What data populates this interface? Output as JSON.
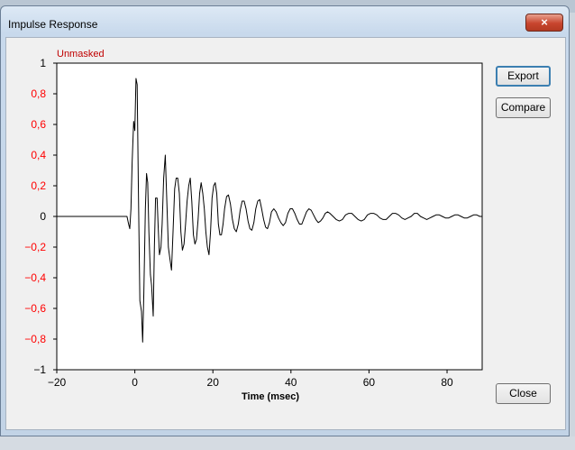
{
  "window": {
    "title": "Impulse Response",
    "close_glyph": "×"
  },
  "status_label": "Unmasked",
  "buttons": {
    "export": "Export",
    "compare": "Compare",
    "close": "Close"
  },
  "colors": {
    "ytick_positive": "#ff0000",
    "ytick_negative": "#ff0000",
    "ytick_axis": "#000000",
    "status": "#c00000"
  },
  "chart_data": {
    "type": "line",
    "title": "",
    "xlabel": "Time (msec)",
    "ylabel": "",
    "xlim": [
      -20,
      89
    ],
    "ylim": [
      -1,
      1
    ],
    "xticks": [
      -20,
      0,
      20,
      40,
      60,
      80
    ],
    "xtick_labels": [
      "−20",
      "0",
      "20",
      "40",
      "60",
      "80"
    ],
    "yticks": [
      1,
      0.8,
      0.6,
      0.4,
      0.2,
      0,
      -0.2,
      -0.4,
      -0.6,
      -0.8,
      -1
    ],
    "ytick_labels": [
      "1",
      "0,8",
      "0,6",
      "0,4",
      "0,2",
      "0",
      "−0,2",
      "−0,4",
      "−0,6",
      "−0,8",
      "−1"
    ],
    "grid": false,
    "series": [
      {
        "name": "",
        "x": [
          -20,
          -2,
          -1.6,
          -1.3,
          -1,
          -0.7,
          -0.3,
          0,
          0.3,
          0.6,
          0.9,
          1.3,
          1.7,
          2,
          2.3,
          2.7,
          3,
          3.3,
          3.6,
          4,
          4.3,
          4.7,
          5,
          5.3,
          5.7,
          6,
          6.3,
          6.7,
          7,
          7.4,
          7.8,
          8.2,
          8.6,
          9,
          9.4,
          9.8,
          10.2,
          10.6,
          11,
          11.4,
          11.8,
          12.2,
          12.6,
          13,
          13.4,
          13.8,
          14.2,
          14.6,
          15,
          15.4,
          15.8,
          16.2,
          16.6,
          17,
          17.4,
          17.8,
          18.2,
          18.6,
          19,
          19.4,
          19.8,
          20.2,
          20.6,
          21,
          21.4,
          21.8,
          22.2,
          22.6,
          23,
          23.5,
          24,
          24.5,
          25,
          25.5,
          26,
          26.5,
          27,
          27.5,
          28,
          28.5,
          29,
          29.5,
          30,
          30.5,
          31,
          31.5,
          32,
          32.5,
          33,
          33.5,
          34,
          34.5,
          35,
          35.6,
          36.2,
          36.8,
          37.4,
          38,
          38.6,
          39.2,
          39.8,
          40.4,
          41,
          41.6,
          42.2,
          42.8,
          43.4,
          44,
          44.6,
          45.2,
          45.8,
          46.4,
          47,
          47.6,
          48.2,
          48.8,
          49.4,
          50,
          50.8,
          51.6,
          52.4,
          53.2,
          54,
          54.8,
          55.6,
          56.4,
          57.2,
          58,
          58.8,
          59.6,
          60.4,
          61.2,
          62,
          62.8,
          63.6,
          64.4,
          65.2,
          66,
          66.8,
          67.6,
          68.4,
          69.2,
          70,
          70.8,
          71.6,
          72.4,
          73.2,
          74,
          74.8,
          75.6,
          76.4,
          77.2,
          78,
          78.8,
          79.6,
          80.4,
          81.2,
          82,
          82.8,
          83.6,
          84.4,
          85.2,
          86,
          86.8,
          87.6,
          88.4,
          89
        ],
        "y": [
          0,
          0,
          -0.05,
          -0.08,
          0.05,
          0.35,
          0.62,
          0.56,
          0.9,
          0.86,
          0.2,
          -0.55,
          -0.62,
          -0.82,
          -0.5,
          0.05,
          0.28,
          0.22,
          -0.1,
          -0.38,
          -0.45,
          -0.65,
          -0.2,
          0.12,
          0.12,
          -0.08,
          -0.25,
          -0.2,
          -0.05,
          0.25,
          0.4,
          0.1,
          -0.2,
          -0.28,
          -0.35,
          -0.1,
          0.18,
          0.25,
          0.25,
          0.15,
          -0.1,
          -0.22,
          -0.18,
          -0.05,
          0.1,
          0.2,
          0.25,
          0.1,
          -0.12,
          -0.18,
          -0.15,
          -0.02,
          0.15,
          0.22,
          0.15,
          0.05,
          -0.1,
          -0.2,
          -0.25,
          -0.1,
          0.12,
          0.2,
          0.22,
          0.15,
          -0.05,
          -0.12,
          -0.12,
          -0.05,
          0.05,
          0.13,
          0.14,
          0.08,
          -0.02,
          -0.08,
          -0.1,
          -0.05,
          0.04,
          0.1,
          0.1,
          0.05,
          -0.03,
          -0.08,
          -0.09,
          -0.04,
          0.05,
          0.1,
          0.11,
          0.05,
          -0.02,
          -0.07,
          -0.08,
          -0.04,
          0.03,
          0.05,
          0.03,
          -0.01,
          -0.04,
          -0.06,
          -0.04,
          0.02,
          0.05,
          0.05,
          0.02,
          -0.02,
          -0.05,
          -0.05,
          -0.01,
          0.03,
          0.05,
          0.04,
          0.01,
          -0.02,
          -0.04,
          -0.03,
          -0.01,
          0.02,
          0.03,
          0.02,
          0,
          -0.02,
          -0.03,
          -0.02,
          0.01,
          0.02,
          0.02,
          0,
          -0.02,
          -0.03,
          -0.02,
          0.01,
          0.02,
          0.02,
          0.01,
          -0.01,
          -0.02,
          -0.02,
          0,
          0.02,
          0.02,
          0.01,
          -0.01,
          -0.02,
          -0.01,
          0,
          0.02,
          0.02,
          0,
          -0.01,
          -0.02,
          -0.01,
          0,
          0.01,
          0.01,
          0,
          -0.01,
          -0.01,
          0,
          0.01,
          0.01,
          0,
          -0.01,
          -0.01,
          0,
          0.01,
          0.01,
          0,
          0
        ]
      }
    ]
  }
}
